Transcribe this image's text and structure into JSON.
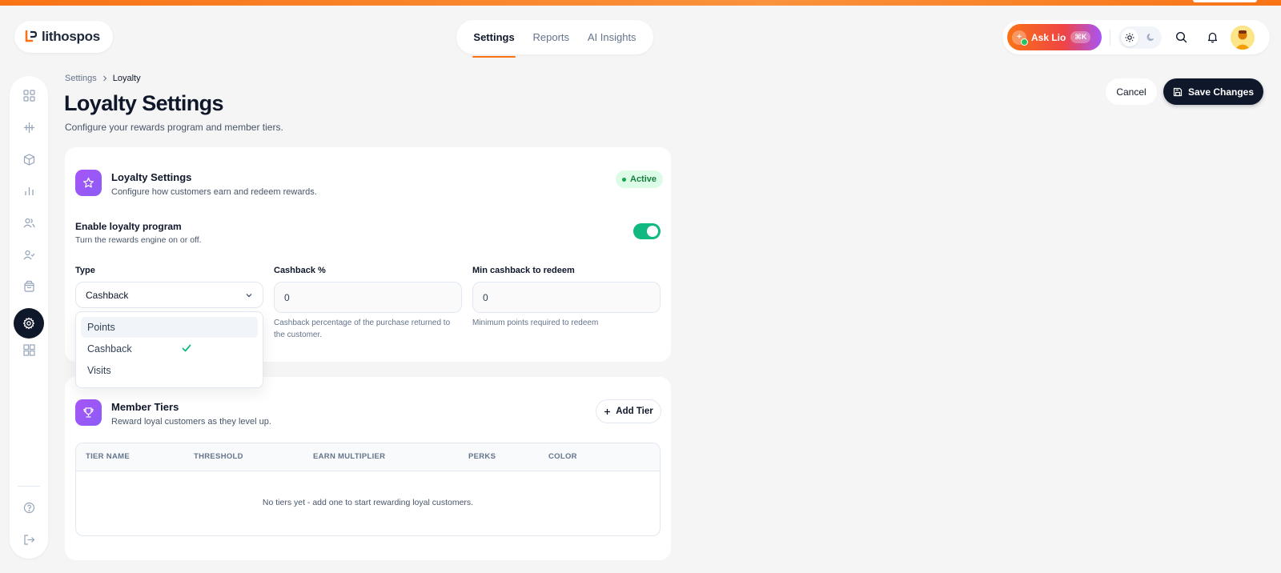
{
  "app": {
    "brand": "lithospos"
  },
  "topnav": {
    "tabs": [
      "Settings",
      "Reports",
      "AI Insights"
    ],
    "active": "Settings"
  },
  "header": {
    "ask_label": "Ask Lio",
    "ask_shortcut": "⌘K"
  },
  "breadcrumb": {
    "parent": "Settings",
    "current": "Loyalty"
  },
  "page": {
    "title": "Loyalty Settings",
    "subtitle": "Configure your rewards program and member tiers.",
    "cancel_label": "Cancel",
    "save_label": "Save Changes"
  },
  "loyalty_card": {
    "title": "Loyalty Settings",
    "subtitle": "Configure how customers earn and redeem rewards.",
    "status": "Active",
    "enable_label": "Enable loyalty program",
    "enable_sub": "Turn the rewards engine on or off.",
    "enabled": true,
    "type_label": "Type",
    "type_value": "Cashback",
    "type_options": [
      "Points",
      "Cashback",
      "Visits"
    ],
    "cashback_label": "Cashback %",
    "cashback_value": "0",
    "cashback_help": "Cashback percentage of the purchase returned to the customer.",
    "min_label": "Min cashback to redeem",
    "min_value": "0",
    "min_help": "Minimum points required to redeem"
  },
  "tiers_card": {
    "title": "Member Tiers",
    "subtitle": "Reward loyal customers as they level up.",
    "add_label": "Add Tier",
    "columns": [
      "TIER NAME",
      "THRESHOLD",
      "EARN MULTIPLIER",
      "PERKS",
      "COLOR"
    ],
    "empty_text": "No tiers yet - add one to start rewarding loyal customers."
  },
  "colors": {
    "accent": "#f97316",
    "primary": "#0f172a",
    "toggle_on": "#10b981",
    "tile": "#8b5cf6"
  },
  "icons": [
    "dashboard-icon",
    "pos-icon",
    "box-icon",
    "chart-icon",
    "users-icon",
    "user-check-icon",
    "bag-icon",
    "settings-icon",
    "apps-icon",
    "help-icon",
    "logout-icon"
  ]
}
